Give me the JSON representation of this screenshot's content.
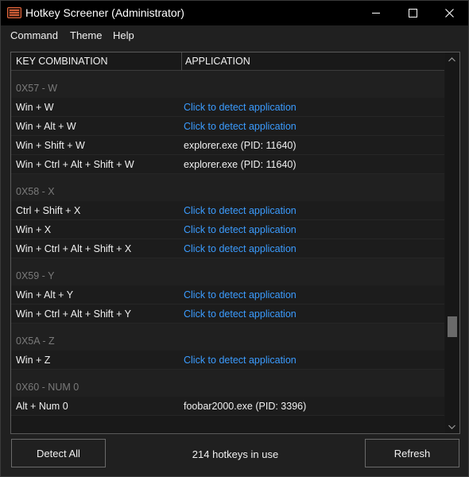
{
  "window": {
    "title": "Hotkey Screener (Administrator)"
  },
  "menu": {
    "command": "Command",
    "theme": "Theme",
    "help": "Help"
  },
  "columns": {
    "key": "KEY COMBINATION",
    "app": "APPLICATION"
  },
  "groups": [
    {
      "label": "0X57 - W",
      "rows": [
        {
          "key": "Win + W",
          "app": "Click to detect application",
          "link": true
        },
        {
          "key": "Win + Alt + W",
          "app": "Click to detect application",
          "link": true
        },
        {
          "key": "Win + Shift + W",
          "app": "explorer.exe (PID: 11640)",
          "link": false
        },
        {
          "key": "Win + Ctrl + Alt + Shift + W",
          "app": "explorer.exe (PID: 11640)",
          "link": false
        }
      ]
    },
    {
      "label": "0X58 - X",
      "rows": [
        {
          "key": "Ctrl + Shift + X",
          "app": "Click to detect application",
          "link": true
        },
        {
          "key": "Win + X",
          "app": "Click to detect application",
          "link": true
        },
        {
          "key": "Win + Ctrl + Alt + Shift + X",
          "app": "Click to detect application",
          "link": true
        }
      ]
    },
    {
      "label": "0X59 - Y",
      "rows": [
        {
          "key": "Win + Alt + Y",
          "app": "Click to detect application",
          "link": true
        },
        {
          "key": "Win + Ctrl + Alt + Shift + Y",
          "app": "Click to detect application",
          "link": true
        }
      ]
    },
    {
      "label": "0X5A - Z",
      "rows": [
        {
          "key": "Win + Z",
          "app": "Click to detect application",
          "link": true
        }
      ]
    },
    {
      "label": "0X60 - NUM 0",
      "rows": [
        {
          "key": "Alt + Num 0",
          "app": "foobar2000.exe (PID: 3396)",
          "link": false
        }
      ]
    }
  ],
  "footer": {
    "detect_all": "Detect All",
    "status": "214 hotkeys in use",
    "refresh": "Refresh"
  },
  "colors": {
    "link": "#3b9cff",
    "group_label": "#7a7a7a",
    "background": "#202020"
  }
}
